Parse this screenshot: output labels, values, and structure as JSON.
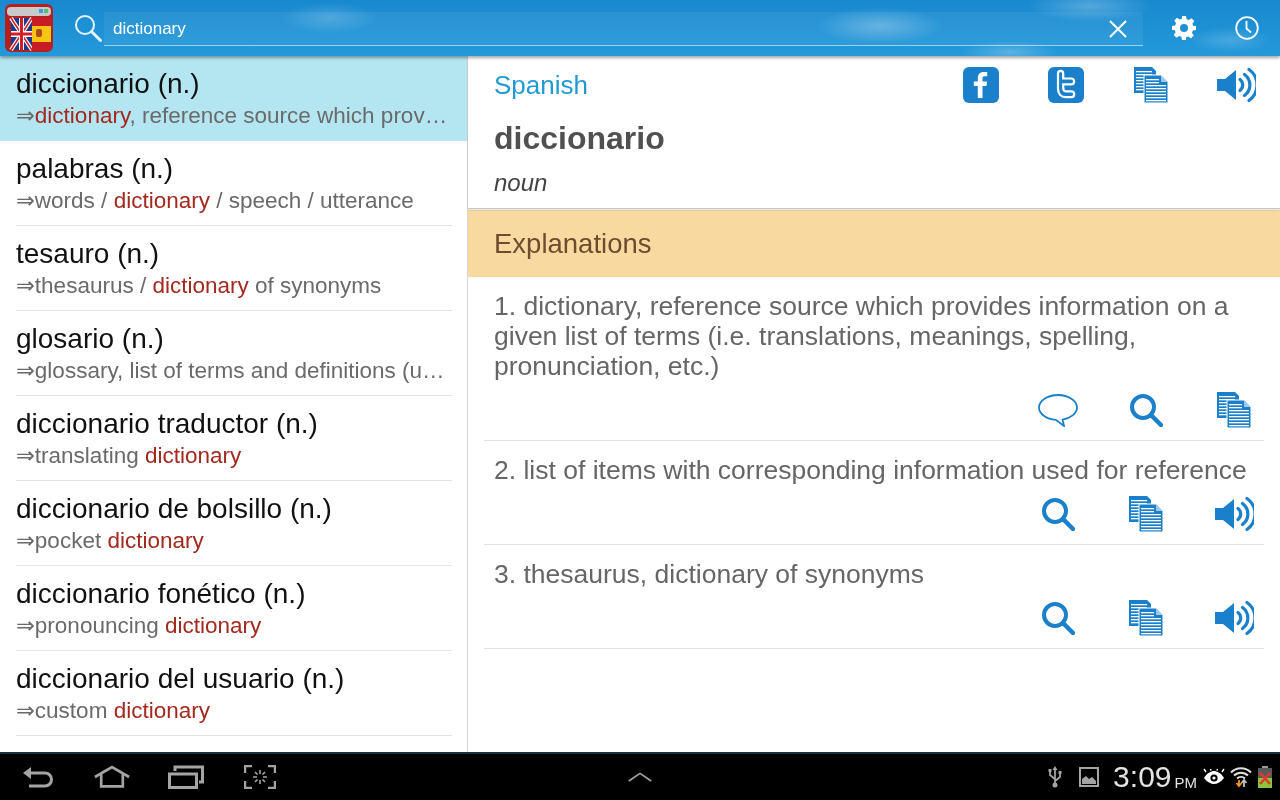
{
  "top_bar": {
    "search": {
      "value": "dictionary"
    }
  },
  "results": [
    {
      "term": "diccionario (n.)",
      "selected": true,
      "gloss": [
        {
          "text": "⇒",
          "match": false
        },
        {
          "text": "dictionary",
          "match": true
        },
        {
          "text": ", reference source which prov…",
          "match": false
        }
      ]
    },
    {
      "term": "palabras (n.)",
      "selected": false,
      "gloss": [
        {
          "text": "⇒words / ",
          "match": false
        },
        {
          "text": "dictionary",
          "match": true
        },
        {
          "text": " / speech / utterance",
          "match": false
        }
      ]
    },
    {
      "term": "tesauro (n.)",
      "selected": false,
      "gloss": [
        {
          "text": "⇒thesaurus / ",
          "match": false
        },
        {
          "text": "dictionary",
          "match": true
        },
        {
          "text": " of synonyms",
          "match": false
        }
      ]
    },
    {
      "term": "glosario (n.)",
      "selected": false,
      "gloss": [
        {
          "text": "⇒glossary, list of terms and definitions (u…",
          "match": false
        }
      ]
    },
    {
      "term": "diccionario traductor (n.)",
      "selected": false,
      "gloss": [
        {
          "text": "⇒translating ",
          "match": false
        },
        {
          "text": "dictionary",
          "match": true
        }
      ]
    },
    {
      "term": "diccionario de bolsillo (n.)",
      "selected": false,
      "gloss": [
        {
          "text": "⇒pocket ",
          "match": false
        },
        {
          "text": "dictionary",
          "match": true
        }
      ]
    },
    {
      "term": "diccionario fonético (n.)",
      "selected": false,
      "gloss": [
        {
          "text": "⇒pronouncing ",
          "match": false
        },
        {
          "text": "dictionary",
          "match": true
        }
      ]
    },
    {
      "term": "diccionario del usuario (n.)",
      "selected": false,
      "gloss": [
        {
          "text": "⇒custom ",
          "match": false
        },
        {
          "text": "dictionary",
          "match": true
        }
      ]
    }
  ],
  "entry": {
    "language": "Spanish",
    "word": "diccionario",
    "part_of_speech": "noun"
  },
  "explanations": {
    "title": "Explanations",
    "items": [
      {
        "text": "1. dictionary, reference source which provides information on a given list of terms (i.e. translations, meanings, spelling, pronunciation, etc.)",
        "actions": [
          {
            "kind": "comment"
          },
          {
            "kind": "search"
          },
          {
            "kind": "copy"
          }
        ]
      },
      {
        "text": "2. list of items with corresponding information used for reference",
        "actions": [
          {
            "kind": "search"
          },
          {
            "kind": "copy"
          },
          {
            "kind": "speak"
          }
        ]
      },
      {
        "text": "3. thesaurus, dictionary of synonyms",
        "actions": [
          {
            "kind": "search"
          },
          {
            "kind": "copy"
          },
          {
            "kind": "speak"
          }
        ]
      }
    ]
  },
  "system_bar": {
    "time": "3:09",
    "meridiem": "PM"
  }
}
